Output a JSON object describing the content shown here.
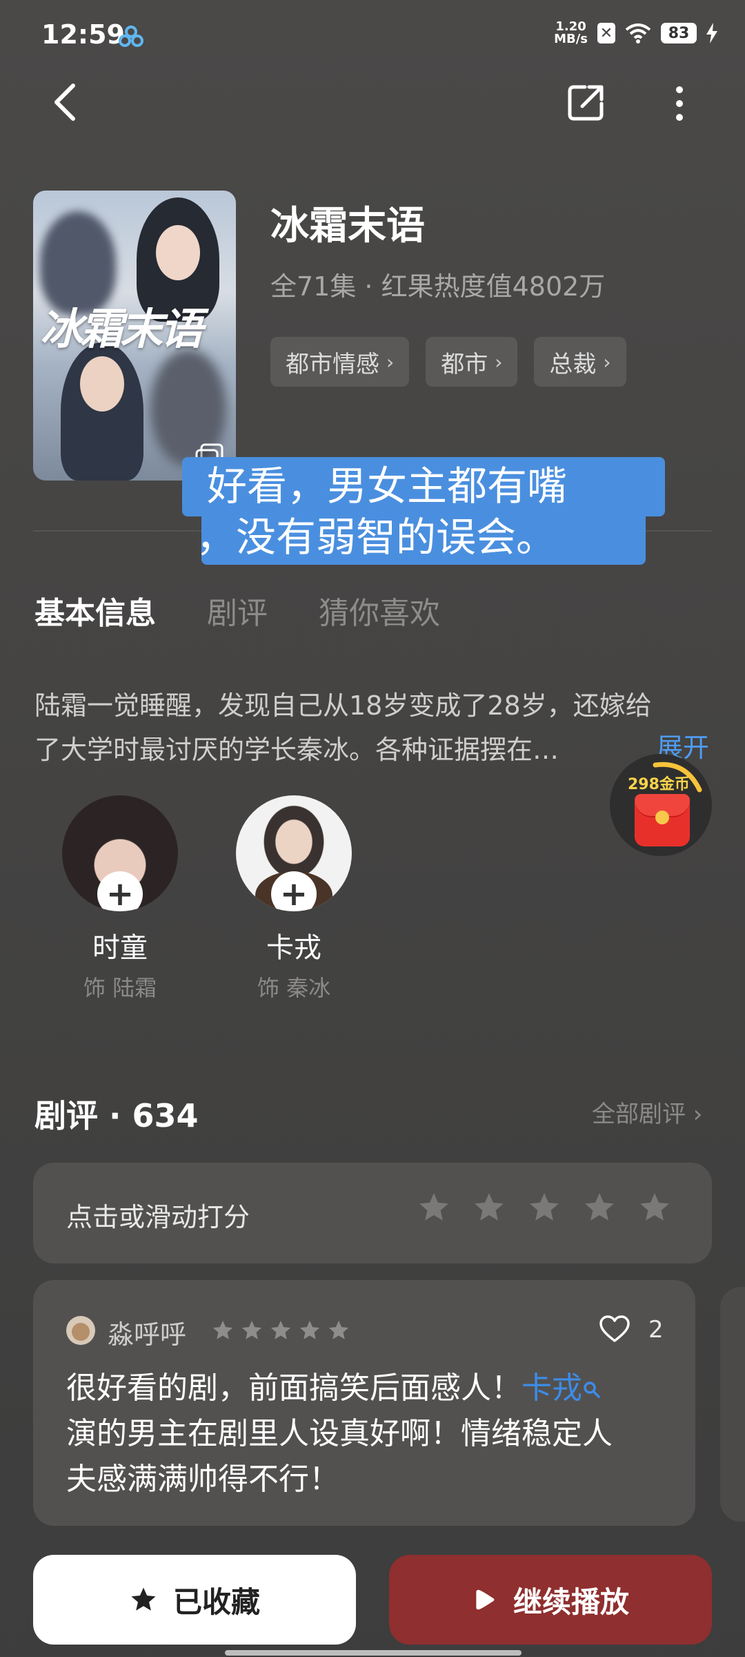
{
  "status_bar": {
    "time": "12:59",
    "net_speed_value": "1.20",
    "net_speed_unit": "MB/s",
    "battery": "83"
  },
  "drama": {
    "poster_title": "冰霜末语",
    "title": "冰霜末语",
    "meta": "全71集 · 红果热度值4802万",
    "tags": [
      "都市情感",
      "都市",
      "总裁"
    ]
  },
  "caption": {
    "line1": "好看，男女主都有嘴",
    "line2": "，没有弱智的误会。"
  },
  "tabs": [
    "基本信息",
    "剧评",
    "猜你喜欢"
  ],
  "synopsis": {
    "line1": "陆霜一觉睡醒，发现自己从18岁变成了28岁，还嫁给",
    "line2": "了大学时最讨厌的学长秦冰。各种证据摆在…",
    "expand_label": "展开"
  },
  "coin_widget": {
    "label": "298金币"
  },
  "cast": [
    {
      "name": "时童",
      "role": "饰 陆霜"
    },
    {
      "name": "卡戎",
      "role": "饰 秦冰"
    }
  ],
  "reviews": {
    "header": "剧评 · 634",
    "all_label": "全部剧评 ›",
    "rating_prompt": "点击或滑动打分",
    "rating_star_count": 5,
    "items": [
      {
        "user": "淼呼呼",
        "stars": 5,
        "likes": "2",
        "text_line1_prefix": "很好看的剧，前面搞笑后面感人！",
        "actor_link": "卡戎",
        "text_line2": "演的男主在剧里人设真好啊！情绪稳定人",
        "text_line3": "夫感满满帅得不行！"
      }
    ]
  },
  "actions": {
    "collect_label": "已收藏",
    "play_label": "继续播放"
  },
  "colors": {
    "accent_blue": "#4f9cf5",
    "play_button": "#8f2f2f",
    "caption_bg": "#4a8fdf"
  }
}
